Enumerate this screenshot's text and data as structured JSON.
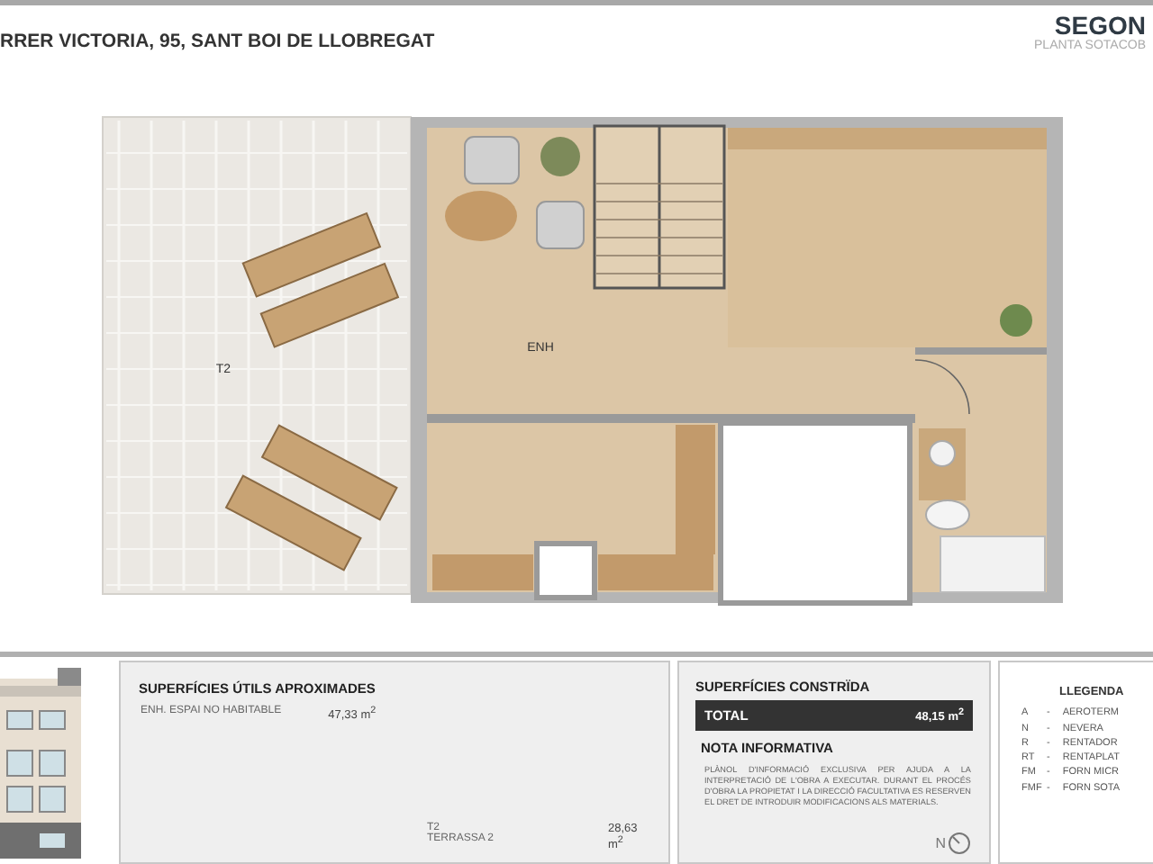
{
  "header": {
    "address": "RRER VICTORIA, 95, SANT BOI DE LLOBREGAT",
    "floor": "SEGON",
    "floor_subtitle": "PLANTA SOTACOB"
  },
  "plan": {
    "labels": [
      {
        "kind": "room",
        "text": "ENH"
      },
      {
        "kind": "terrace",
        "text": "T2"
      }
    ]
  },
  "useful_areas": {
    "title": "SUPERFÍCIES ÚTILS APROXIMADES",
    "rows": [
      {
        "name": "ENH. ESPAI NO HABITABLE",
        "area": "47,33 m$^{2}$"
      },
      {
        "name": "T2  TERRASSA 2",
        "area": "28,63  m$^{2}$"
      }
    ]
  },
  "built_area": {
    "title": "SUPERFÍCIES CONSTRÏDA",
    "total_label": "TOTAL",
    "total_value": "48,15 m$^{2}$"
  },
  "note": {
    "title": "NOTA INFORMATIVA",
    "text": "PLÀNOL D'INFORMACIÓ EXCLUSIVA PER AJUDA A LA INTERPRETACIÓ DE L'OBRA A EXECUTAR. DURANT EL PROCÉS D'OBRA LA PROPIETAT I LA DIRECCIÓ FACULTATIVA ES RESERVEN EL DRET DE INTRODUIR MODIFICACIONS ALS MATERIALS.",
    "north": "N"
  },
  "legend": {
    "title": "LLEGENDA",
    "items": [
      {
        "code": "A",
        "sep": "-",
        "name": "AEROTERM"
      },
      {
        "code": "N",
        "sep": "-",
        "name": "NEVERA"
      },
      {
        "code": "R",
        "sep": "-",
        "name": "RENTADOR"
      },
      {
        "code": "RT",
        "sep": "-",
        "name": "RENTAPLAT"
      },
      {
        "code": "FM",
        "sep": "-",
        "name": "FORN MICR"
      },
      {
        "code": "FMF",
        "sep": "-",
        "name": "FORN SOTA"
      }
    ]
  }
}
